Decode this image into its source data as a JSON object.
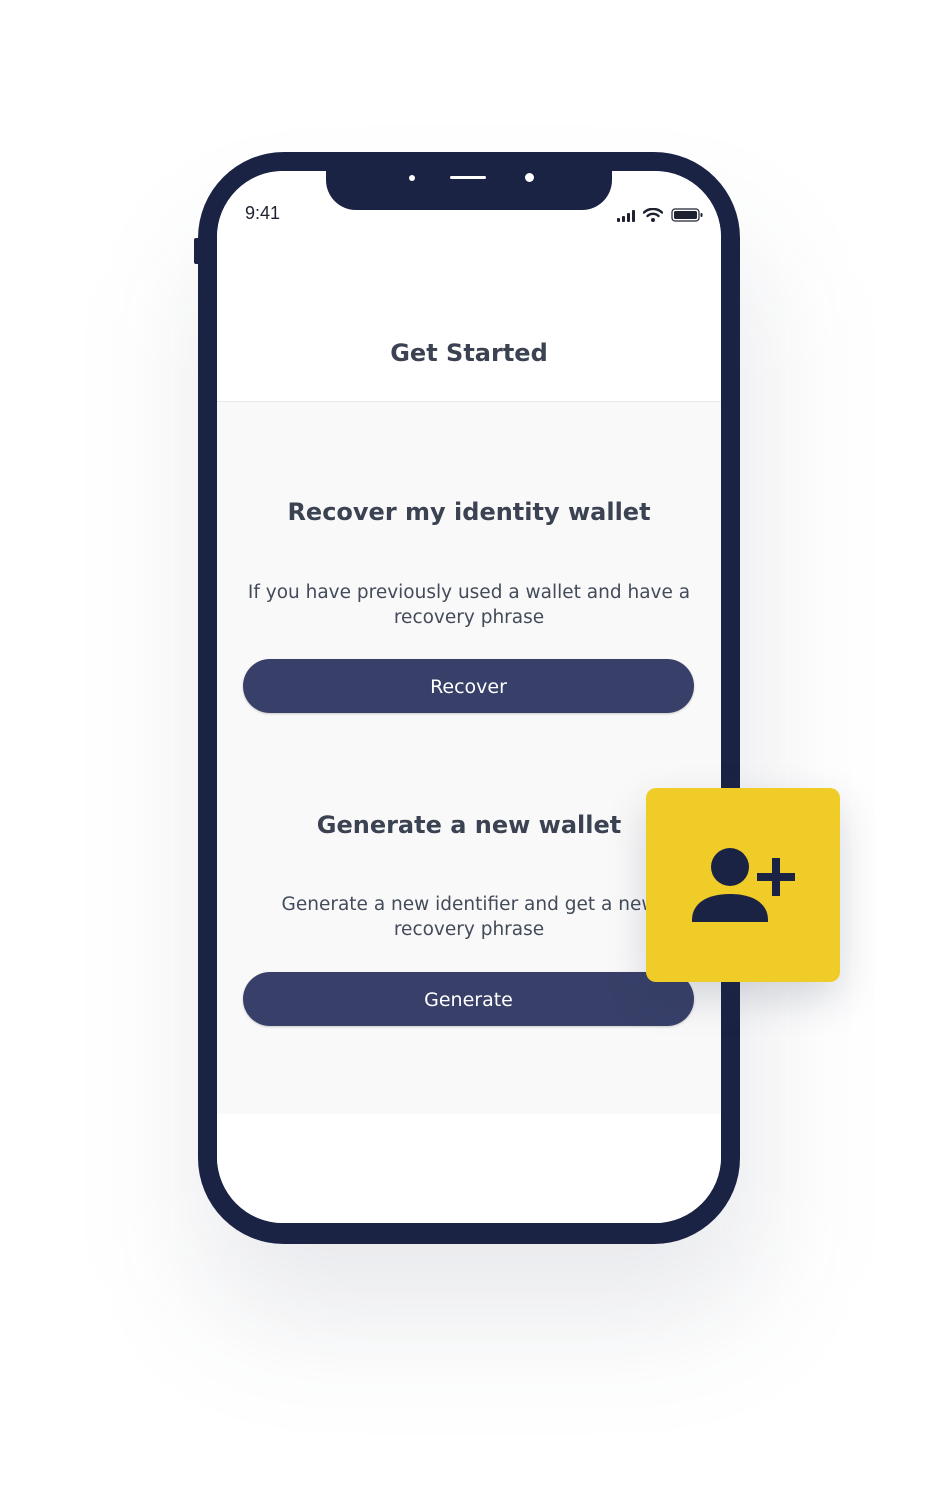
{
  "status_bar": {
    "time": "9:41",
    "signal_icon": "cellular-signal-icon",
    "wifi_icon": "wifi-icon",
    "battery_icon": "battery-icon"
  },
  "header": {
    "title": "Get Started"
  },
  "recover": {
    "title": "Recover my identity wallet",
    "description": "If you have previously used a wallet and have a recovery phrase",
    "button_label": "Recover"
  },
  "generate": {
    "title": "Generate a new wallet",
    "description": "Generate a new identifier and get a new recovery phrase",
    "button_label": "Generate"
  },
  "badge": {
    "icon": "add-user-icon",
    "color": "#f0cc28",
    "icon_color": "#1b2345"
  },
  "colors": {
    "phone_frame": "#1b2345",
    "button": "#384069",
    "title_text": "#3b4352"
  }
}
